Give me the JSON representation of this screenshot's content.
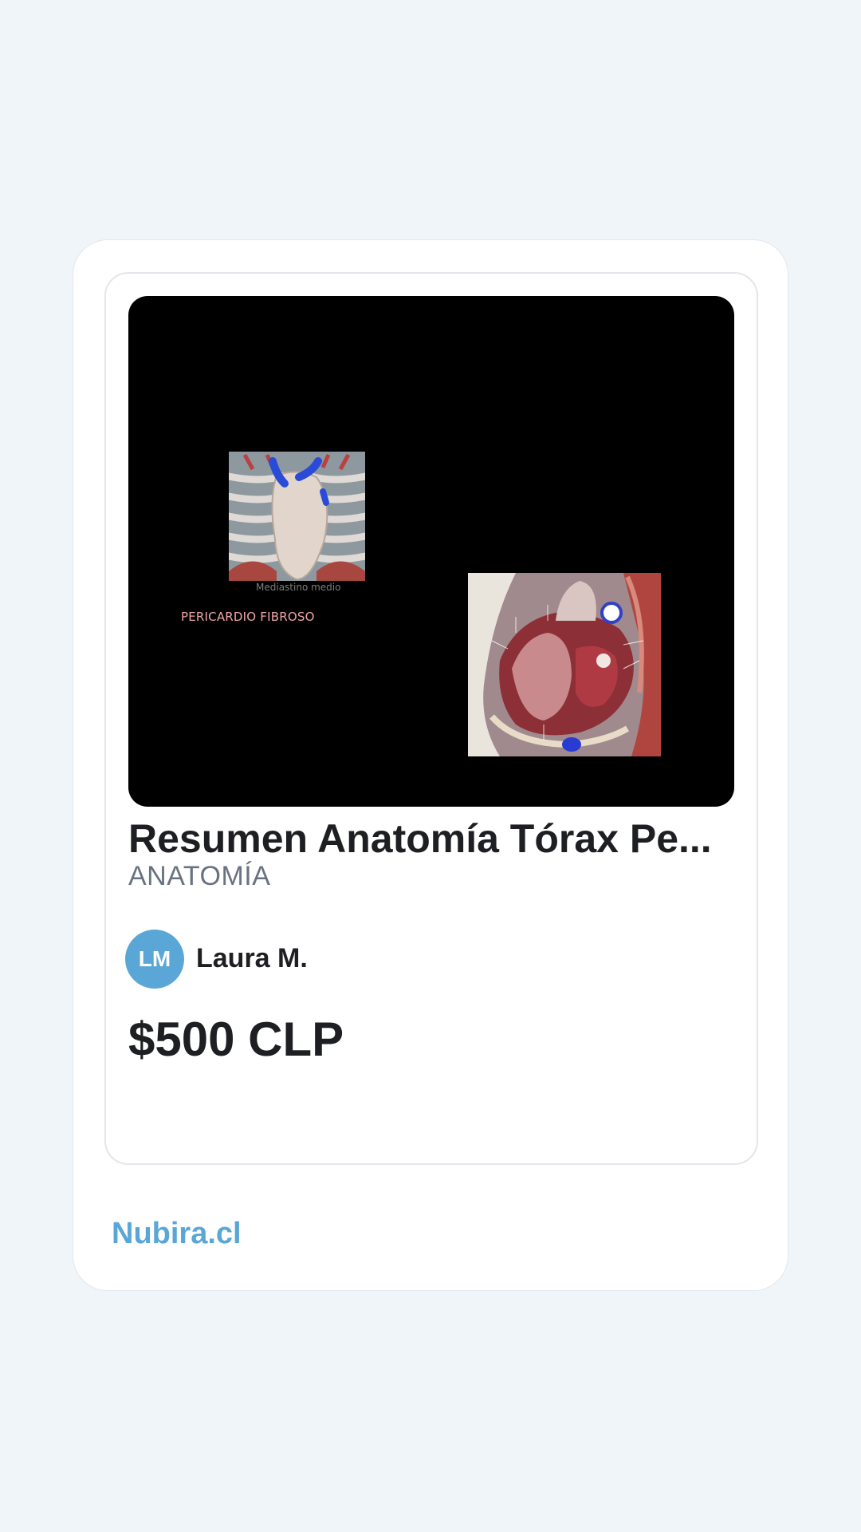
{
  "listing": {
    "image": {
      "caption_top": "Mediastino medio",
      "caption_label": "PERICARDIO FIBROSO"
    },
    "title": "Resumen Anatomía Tórax Pe...",
    "category": "ANATOMÍA",
    "seller": {
      "initials": "LM",
      "name": "Laura M."
    },
    "price": "$500 CLP"
  },
  "footer": {
    "brand": "Nubira.cl"
  },
  "colors": {
    "accent": "#5aa7d7",
    "background": "#f0f5f9",
    "text": "#1e1f22",
    "muted": "#6a7282"
  }
}
